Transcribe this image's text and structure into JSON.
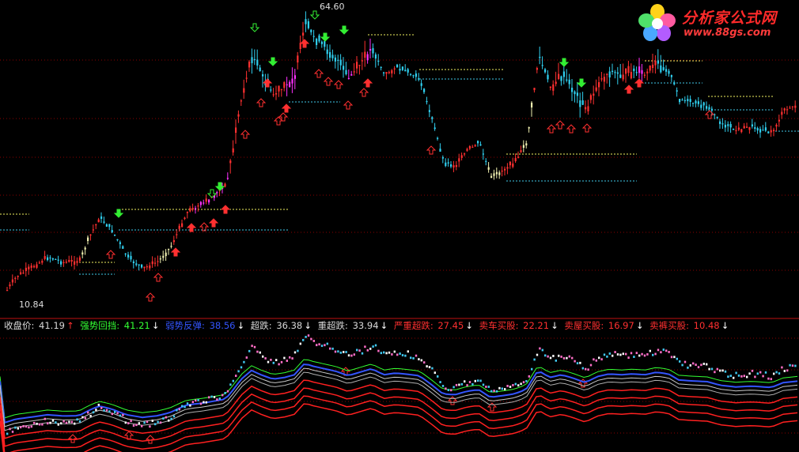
{
  "chart": {
    "high_label": "64.60",
    "low_label": "10.84"
  },
  "legend": {
    "items": [
      {
        "label": "收盘价:",
        "value": "41.19",
        "arrow": "↑",
        "color": "#d8d8d8",
        "arrow_color": "#ff3030"
      },
      {
        "label": "强势回挡:",
        "value": "41.21",
        "arrow": "↓",
        "color": "#33ff33",
        "arrow_color": "#ffffff"
      },
      {
        "label": "弱势反弹:",
        "value": "38.56",
        "arrow": "↓",
        "color": "#3355ff",
        "arrow_color": "#ffffff"
      },
      {
        "label": "超跌:",
        "value": "36.38",
        "arrow": "↓",
        "color": "#d8d8d8",
        "arrow_color": "#ffffff"
      },
      {
        "label": "重超跌:",
        "value": "33.94",
        "arrow": "↓",
        "color": "#d8d8d8",
        "arrow_color": "#ffffff"
      },
      {
        "label": "严重超跌:",
        "value": "27.45",
        "arrow": "↓",
        "color": "#ff3030",
        "arrow_color": "#ffffff"
      },
      {
        "label": "卖车买股:",
        "value": "22.21",
        "arrow": "↓",
        "color": "#ff3030",
        "arrow_color": "#ffffff"
      },
      {
        "label": "卖屋买股:",
        "value": "16.97",
        "arrow": "↓",
        "color": "#ff3030",
        "arrow_color": "#ffffff"
      },
      {
        "label": "卖裤买股:",
        "value": "10.48",
        "arrow": "↓",
        "color": "#ff3030",
        "arrow_color": "#ffffff"
      }
    ]
  },
  "logo": {
    "brand": "分析家公式网",
    "site": "www.88gs.com"
  },
  "colors": {
    "up": "#ff3030",
    "down": "#30d0f0",
    "magenta": "#ff30ff",
    "grid": "#8b0000",
    "level_yellow": "#f0f060",
    "level_cyan": "#40c8e8"
  }
}
